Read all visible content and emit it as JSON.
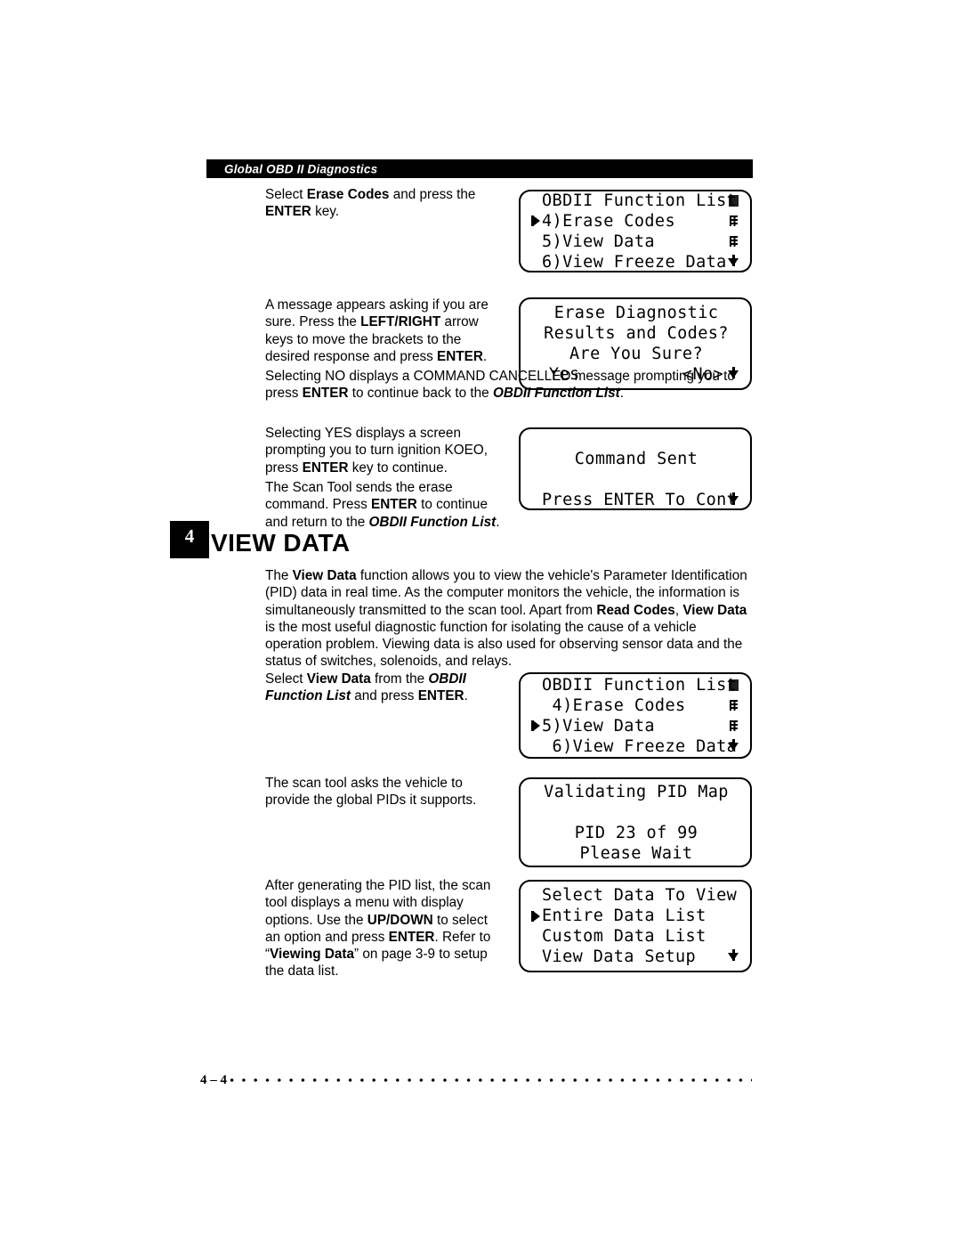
{
  "running_head": "Global OBD II Diagnostics",
  "section": {
    "number": "4",
    "title": "VIEW DATA"
  },
  "paragraphs": {
    "p1_select_erase": "Select <b>Erase Codes</b> and press the <b>ENTER</b> key.",
    "p2_message": "A message appears asking if you are sure. Press the <b>LEFT/RIGHT</b> arrow keys to move the brackets to the desired response and press <b>ENTER</b>.",
    "p3_no": "Selecting NO displays a COMMAND CANCELLED message prompting you to press <b>ENTER</b> to continue back to the <span class=\"bi\">OBDII Function List</span>.",
    "p4_yes": "Selecting YES displays a screen prompting you to turn ignition KOEO, press <b>ENTER</b> key to continue.",
    "p5_erase_cmd": "The Scan Tool sends the erase command. Press <b>ENTER</b> to continue and return to the <span class=\"bi\">OBDII Function List</span>.",
    "p6_view_data_intro": "The <b>View Data</b> function allows you to view the vehicle's Parameter Identification (PID) data in real time. As the computer monitors the vehicle, the information is simultaneously transmitted to the scan tool. Apart from <b>Read Codes</b>, <b>View Data</b> is the most useful diagnostic function for isolating the cause of a vehicle operation problem. Viewing data is also used for observing sensor data and the status of switches, solenoids, and relays.",
    "p7_select_view_data": "Select <b>View Data</b> from the <span class=\"bi\">OBDII Function List</span> and press <b>ENTER</b>.",
    "p8_scan_asks": "The scan tool asks the vehicle to provide the global PIDs it supports.",
    "p9_after_pid": "After generating the PID list, the scan tool displays a menu with display options. Use the <b>UP/DOWN</b> to select an option and press <b>ENTER</b>. Refer to “<b>Viewing Data</b>” on page 3-9 to setup the data list."
  },
  "lcd_screens": [
    {
      "id": "lcd-obdii-function-list-erase",
      "lines": [
        {
          "text": "OBDII Function List",
          "cursor": false,
          "align": "left",
          "scroll": "top-solid"
        },
        {
          "text": "4)Erase Codes",
          "cursor": true,
          "align": "left",
          "scroll": "dots"
        },
        {
          "text": "5)View Data",
          "cursor": false,
          "align": "left",
          "scroll": "dots"
        },
        {
          "text": "6)View Freeze Data",
          "cursor": false,
          "align": "left",
          "scroll": "arrow"
        }
      ]
    },
    {
      "id": "lcd-erase-confirm",
      "lines": [
        {
          "text": "Erase Diagnostic",
          "cursor": false,
          "align": "center",
          "scroll": "none"
        },
        {
          "text": "Results and Codes?",
          "cursor": false,
          "align": "center",
          "scroll": "none"
        },
        {
          "text": "Are You Sure?",
          "cursor": false,
          "align": "center",
          "scroll": "none"
        },
        {
          "text": "Yes          <No>",
          "cursor": false,
          "align": "center",
          "scroll": "arrow"
        }
      ]
    },
    {
      "id": "lcd-command-sent",
      "lines": [
        {
          "text": "",
          "cursor": false,
          "align": "center",
          "scroll": "none"
        },
        {
          "text": "Command Sent",
          "cursor": false,
          "align": "center",
          "scroll": "none"
        },
        {
          "text": "",
          "cursor": false,
          "align": "center",
          "scroll": "none"
        },
        {
          "text": "Press ENTER To Cont",
          "cursor": false,
          "align": "left",
          "scroll": "arrow"
        }
      ]
    },
    {
      "id": "lcd-obdii-function-list-view",
      "lines": [
        {
          "text": "OBDII Function List",
          "cursor": false,
          "align": "left",
          "scroll": "top-solid"
        },
        {
          "text": " 4)Erase Codes",
          "cursor": false,
          "align": "left",
          "scroll": "dots"
        },
        {
          "text": "5)View Data",
          "cursor": true,
          "align": "left",
          "scroll": "dots"
        },
        {
          "text": " 6)View Freeze Data",
          "cursor": false,
          "align": "left",
          "scroll": "arrow"
        }
      ]
    },
    {
      "id": "lcd-validating-pid-map",
      "lines": [
        {
          "text": "Validating PID Map",
          "cursor": false,
          "align": "center",
          "scroll": "none"
        },
        {
          "text": "",
          "cursor": false,
          "align": "center",
          "scroll": "none"
        },
        {
          "text": "PID 23 of 99",
          "cursor": false,
          "align": "center",
          "scroll": "none"
        },
        {
          "text": "Please Wait",
          "cursor": false,
          "align": "center",
          "scroll": "none"
        }
      ]
    },
    {
      "id": "lcd-select-data-to-view",
      "lines": [
        {
          "text": "Select Data To View",
          "cursor": false,
          "align": "left",
          "scroll": "none"
        },
        {
          "text": "Entire Data List",
          "cursor": true,
          "align": "left",
          "scroll": "none"
        },
        {
          "text": "Custom Data List",
          "cursor": false,
          "align": "left",
          "scroll": "none"
        },
        {
          "text": "View Data Setup",
          "cursor": false,
          "align": "left",
          "scroll": "arrow"
        }
      ]
    }
  ],
  "footer": {
    "page_number": "4 – 4"
  }
}
